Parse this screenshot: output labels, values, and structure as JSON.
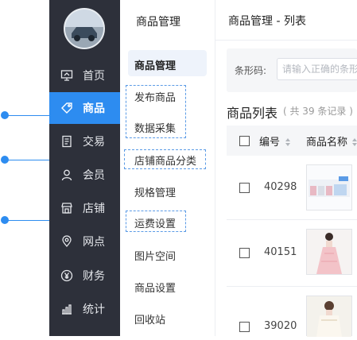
{
  "nav": {
    "items": [
      {
        "label": "首页",
        "icon": "presentation-icon"
      },
      {
        "label": "商品",
        "icon": "tag-icon",
        "active": true
      },
      {
        "label": "交易",
        "icon": "receipt-icon"
      },
      {
        "label": "会员",
        "icon": "user-icon"
      },
      {
        "label": "店铺",
        "icon": "store-icon"
      },
      {
        "label": "网点",
        "icon": "location-icon"
      },
      {
        "label": "财务",
        "icon": "yen-icon"
      },
      {
        "label": "统计",
        "icon": "bar-chart-icon"
      }
    ]
  },
  "subnav": {
    "title": "商品管理",
    "items": [
      "商品管理",
      "发布商品",
      "数据采集",
      "店铺商品分类",
      "规格管理",
      "运费设置",
      "图片空间",
      "商品设置",
      "回收站"
    ]
  },
  "main": {
    "breadcrumb": "商品管理 - 列表",
    "filter_label": "条形码:",
    "filter_placeholder": "请输入正确的条形码",
    "list_title": "商品列表",
    "list_count": "( 共 39 条记录 )",
    "columns": [
      "编号",
      "商品名称"
    ],
    "rows": [
      {
        "id": "40298"
      },
      {
        "id": "40151"
      },
      {
        "id": "39020"
      }
    ]
  },
  "colors": {
    "accent": "#2d8cf0",
    "nav_bg": "#2d303a"
  }
}
